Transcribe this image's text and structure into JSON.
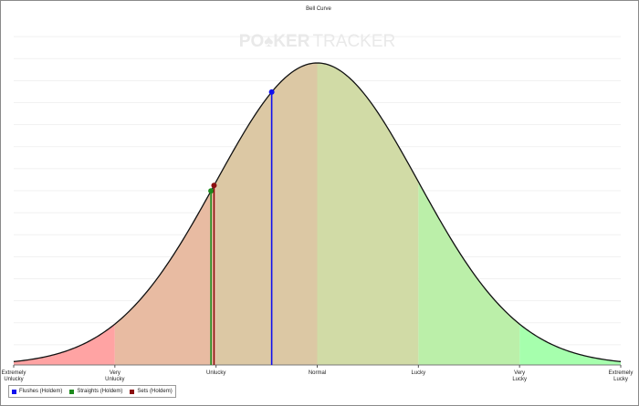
{
  "chart_data": {
    "type": "area",
    "title": "Bell Curve",
    "watermark": {
      "left": "PO",
      "suit": "♠",
      "mid": "KER",
      "right": "TRACKER"
    },
    "x_range": [
      -3,
      3
    ],
    "zones": [
      {
        "from": -3,
        "to": -2,
        "color": "#ffa3a3"
      },
      {
        "from": -2,
        "to": -1,
        "color": "#e8bba2"
      },
      {
        "from": -1,
        "to": 0,
        "color": "#dcc8a4"
      },
      {
        "from": 0,
        "to": 1,
        "color": "#d1dba6"
      },
      {
        "from": 1,
        "to": 2,
        "color": "#bbefa9"
      },
      {
        "from": 2,
        "to": 3,
        "color": "#a6ffad"
      }
    ],
    "ticks": [
      {
        "x": -3,
        "lines": [
          "Extremely",
          "Unlucky"
        ]
      },
      {
        "x": -2,
        "lines": [
          "Very",
          "Unlucky"
        ]
      },
      {
        "x": -1,
        "lines": [
          "Unlucky"
        ]
      },
      {
        "x": 0,
        "lines": [
          "Normal"
        ]
      },
      {
        "x": 1,
        "lines": [
          "Lucky"
        ]
      },
      {
        "x": 2,
        "lines": [
          "Very",
          "Lucky"
        ]
      },
      {
        "x": 3,
        "lines": [
          "Extremely",
          "Lucky"
        ]
      }
    ],
    "series": [
      {
        "name": "Flushes (Holdem)",
        "x": -0.45,
        "color": "#1010ee"
      },
      {
        "name": "Straights (Holdem)",
        "x": -1.05,
        "color": "#1d8a1d"
      },
      {
        "name": "Sets (Holdem)",
        "x": -1.02,
        "color": "#8b1010"
      }
    ],
    "grid": true,
    "legend_position": "bottom-left"
  }
}
